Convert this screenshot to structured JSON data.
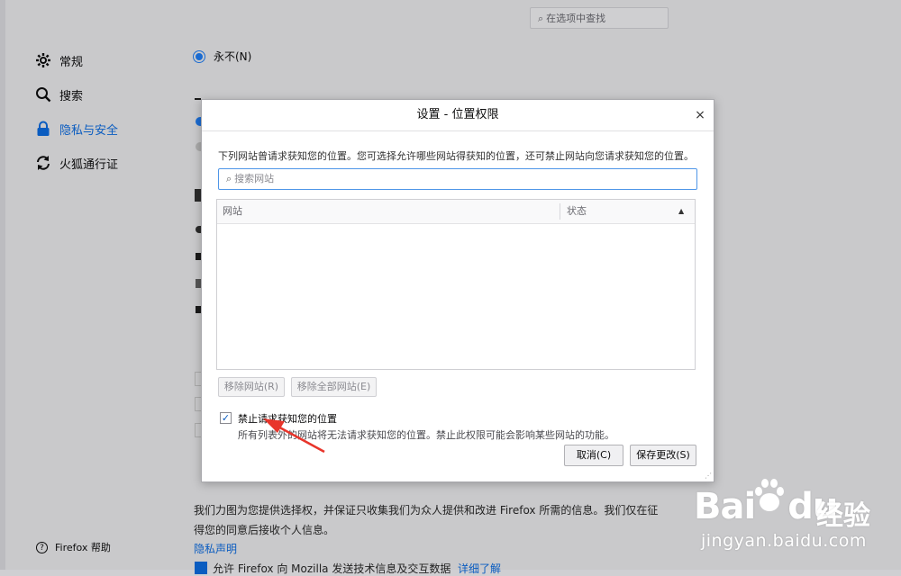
{
  "background": {
    "search_placeholder": "在选项中查找",
    "nav": [
      {
        "label": "常规",
        "icon": "gear-icon"
      },
      {
        "label": "搜索",
        "icon": "search-icon"
      },
      {
        "label": "隐私与安全",
        "icon": "lock-icon"
      },
      {
        "label": "火狐通行证",
        "icon": "sync-icon"
      }
    ],
    "help_label": "Firefox 帮助",
    "never_radio_label": "永不(N)",
    "firefox_data_text_line1": "我们力图为您提供选择权，并保证只收集我们为众人提供和改进 Firefox 所需的信息。我们仅在征",
    "firefox_data_text_line2": "得您的同意后接收个人信息。",
    "privacy_link": "隐私声明",
    "allow_checkbox_label": "允许 Firefox 向 Mozilla 发送技术信息及交互数据",
    "learn_more_link": "详细了解"
  },
  "dialog": {
    "title": "设置 - 位置权限",
    "description": "下列网站曾请求获知您的位置。您可选择允许哪些网站得获知的位置，还可禁止网站向您请求获知您的位置。",
    "search_placeholder": "搜索网站",
    "col_site": "网站",
    "col_status": "状态",
    "sort_glyph": "▲",
    "remove_site": "移除网站(R)",
    "remove_all": "移除全部网站(E)",
    "block_checkbox_label": "禁止请求获知您的位置",
    "block_checked": true,
    "block_description": "所有列表外的网站将无法请求获知您的位置。禁止此权限可能会影响某些网站的功能。",
    "cancel": "取消(C)",
    "save": "保存更改(S)",
    "close_glyph": "×"
  },
  "watermark": {
    "brand": "Bai",
    "brand_suffix": "du",
    "jingyan": "经验",
    "url": "jingyan.baidu.com"
  },
  "colors": {
    "accent": "#0a5cc0",
    "overlay": "#c9c9cb",
    "arrow": "#e8352b"
  }
}
